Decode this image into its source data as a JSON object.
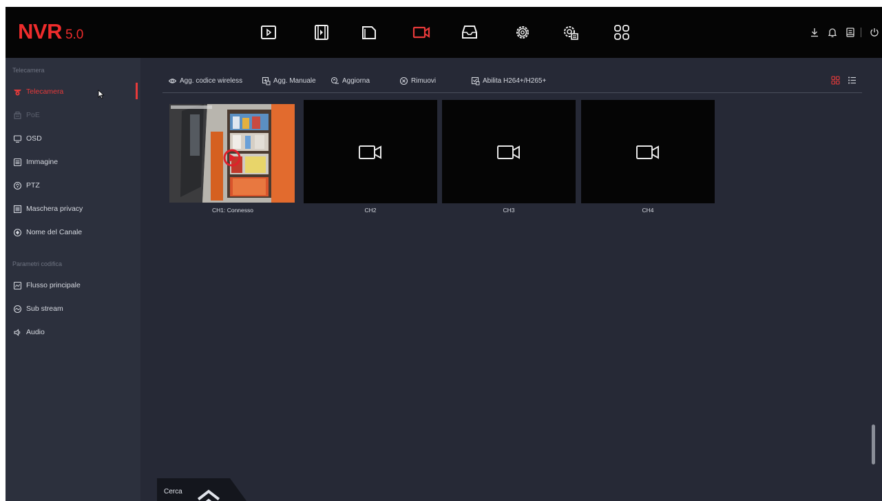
{
  "app": {
    "logo_brand": "NVR",
    "logo_version": "5.0",
    "accent_color": "#e83a3a"
  },
  "topnav": {
    "icons": [
      "playback-icon",
      "video-clip-icon",
      "file-folder-icon",
      "camera-icon",
      "storage-icon",
      "settings-gear-icon",
      "system-settings-icon",
      "apps-grid-icon"
    ],
    "active": "camera-icon",
    "right_icons": [
      "download-icon",
      "bell-icon",
      "user-account-icon",
      "power-icon"
    ]
  },
  "sidebar": {
    "section1": "Telecamera",
    "items1": [
      {
        "label": "Telecamera",
        "icon": "camera-icon",
        "state": "active"
      },
      {
        "label": "PoE",
        "icon": "poe-icon",
        "state": "disabled"
      },
      {
        "label": "OSD",
        "icon": "monitor-icon",
        "state": "normal"
      },
      {
        "label": "Immagine",
        "icon": "image-icon",
        "state": "normal"
      },
      {
        "label": "PTZ",
        "icon": "ptz-icon",
        "state": "normal"
      },
      {
        "label": "Maschera privacy",
        "icon": "privacy-mask-icon",
        "state": "normal"
      },
      {
        "label": "Nome del Canale",
        "icon": "channel-name-icon",
        "state": "normal"
      }
    ],
    "section2": "Parametri codifica",
    "items2": [
      {
        "label": "Flusso principale",
        "icon": "main-stream-icon",
        "state": "normal"
      },
      {
        "label": "Sub stream",
        "icon": "sub-stream-icon",
        "state": "normal"
      },
      {
        "label": "Audio",
        "icon": "audio-icon",
        "state": "normal"
      }
    ]
  },
  "toolbar": {
    "add_wireless": "Agg. codice wireless",
    "add_manual": "Agg. Manuale",
    "refresh": "Aggiorna",
    "remove": "Rimuovi",
    "enable_h264": "Abilita H264+/H265+"
  },
  "channels": [
    {
      "label": "CH1: Connesso",
      "has_video": true
    },
    {
      "label": "CH2",
      "has_video": false
    },
    {
      "label": "CH3",
      "has_video": false
    },
    {
      "label": "CH4",
      "has_video": false
    }
  ],
  "footer": {
    "search_label": "Cerca"
  }
}
